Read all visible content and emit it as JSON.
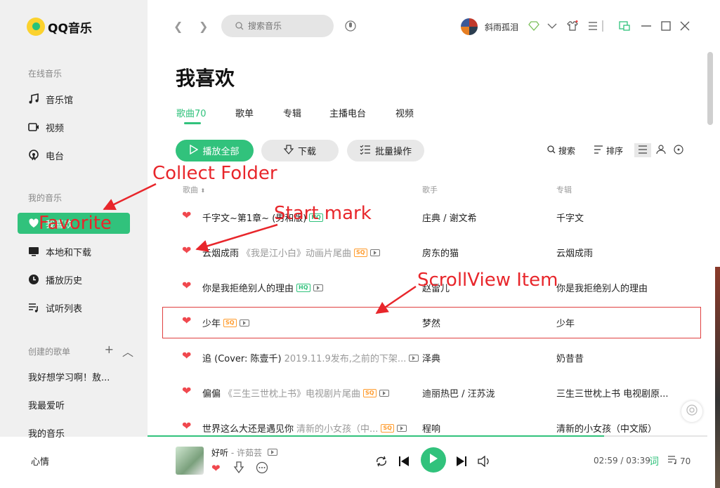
{
  "app": {
    "name": "QQ音乐"
  },
  "sidebar": {
    "online_title": "在线音乐",
    "online_items": [
      {
        "label": "音乐馆",
        "icon": "music-note-icon"
      },
      {
        "label": "视频",
        "icon": "video-icon"
      },
      {
        "label": "电台",
        "icon": "radio-icon"
      }
    ],
    "mine_title": "我的音乐",
    "mine_items": [
      {
        "label": "我喜欢",
        "icon": "heart-icon",
        "active": true
      },
      {
        "label": "本地和下载",
        "icon": "monitor-icon"
      },
      {
        "label": "播放历史",
        "icon": "clock-icon"
      },
      {
        "label": "试听列表",
        "icon": "playlist-icon"
      }
    ],
    "created_title": "创建的歌单",
    "playlists": [
      "我好想学习啊！敖...",
      "我最爱听",
      "我的音乐",
      "心情"
    ]
  },
  "header": {
    "search_placeholder": "搜索音乐",
    "username": "斜雨孤泪"
  },
  "main": {
    "title": "我喜欢",
    "tabs": [
      "歌曲70",
      "歌单",
      "专辑",
      "主播电台",
      "视频"
    ],
    "active_tab": 0,
    "buttons": {
      "play_all": "播放全部",
      "download": "下载",
      "batch": "批量操作"
    },
    "tools": {
      "search": "搜索",
      "sort": "排序"
    },
    "columns": {
      "song": "歌曲",
      "artist": "歌手",
      "album": "专辑"
    },
    "songs": [
      {
        "title": "千字文~第1章~ (男和版)",
        "note": "",
        "badge": "HQ",
        "mv": false,
        "artist": "庄典 / 谢文希",
        "album": "千字文"
      },
      {
        "title": "云烟成雨",
        "note": "《我是江小白》动画片尾曲",
        "badge": "SQ",
        "mv": true,
        "artist": "房东的猫",
        "album": "云烟成雨"
      },
      {
        "title": "你是我拒绝别人的理由",
        "note": "",
        "badge": "HQ",
        "mv": true,
        "artist": "赵雷儿",
        "album": "你是我拒绝别人的理由"
      },
      {
        "title": "少年",
        "note": "",
        "badge": "SQ",
        "mv": true,
        "artist": "梦然",
        "album": "少年"
      },
      {
        "title": "追 (Cover: 陈壹千)",
        "note": "2019.11.9发布,之前的下架...",
        "badge": "",
        "mv": true,
        "artist": "泽典",
        "album": "奶昔昔"
      },
      {
        "title": "偏偏",
        "note": "《三生三世枕上书》电视剧片尾曲",
        "badge": "SQ",
        "mv": true,
        "artist": "迪丽热巴 / 汪苏泷",
        "album": "三生三世枕上书 电视剧原..."
      },
      {
        "title": "世界这么大还是遇见你",
        "note": "清新的小女孩（中...",
        "badge": "SQ",
        "mv": true,
        "artist": "程响",
        "album": "清新的小女孩（中文版）"
      }
    ]
  },
  "player": {
    "title": "好听",
    "artist": "许茹芸",
    "sep": " - ",
    "current": "02:59",
    "total": "03:39",
    "time": "02:59 / 03:39",
    "lyric": "词",
    "queue_count": "70",
    "progress": 0.816
  },
  "annotations": {
    "collect_folder": "Collect Folder",
    "favorite": "Favorite",
    "start_mark": "Start mark",
    "scrollview_item": "ScrollView Item"
  },
  "colors": {
    "accent": "#31c27c",
    "heart": "#f0484e",
    "annotation": "#e8262b"
  }
}
